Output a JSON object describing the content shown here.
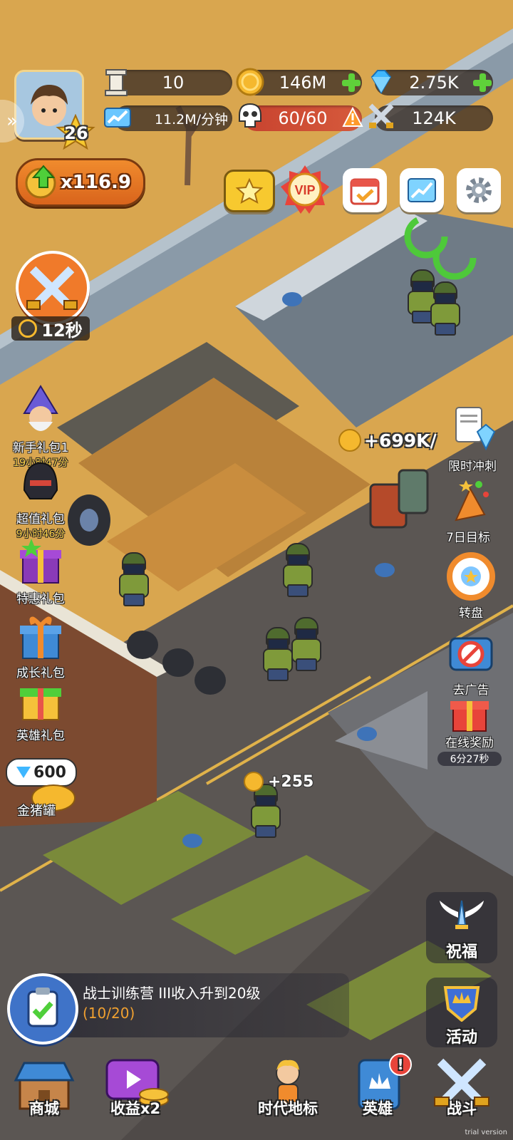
{
  "hud": {
    "level": "26",
    "pillar_count": "10",
    "coins": "146M",
    "gems": "2.75K",
    "income_rate": "11.2M/分钟",
    "population": "60/60",
    "power": "124K",
    "multiplier": "x116.9",
    "battle_timer": "12秒"
  },
  "left_menu": [
    {
      "label": "新手礼包1",
      "timer": "19小时47分"
    },
    {
      "label": "超值礼包",
      "timer": "9小时46分"
    },
    {
      "label": "特惠礼包",
      "timer": ""
    },
    {
      "label": "成长礼包",
      "timer": ""
    },
    {
      "label": "英雄礼包",
      "timer": ""
    }
  ],
  "piggy": {
    "value": "600",
    "label": "金猪罐"
  },
  "right_menu": [
    {
      "label": "限时冲刺"
    },
    {
      "label": "7日目标"
    },
    {
      "label": "转盘"
    },
    {
      "label": "去广告"
    },
    {
      "label": "在线奖励",
      "timer": "6分27秒"
    }
  ],
  "map_floats": {
    "income_popup": "+699K/",
    "coin_popup": "+255"
  },
  "right_bottom": {
    "blessing": "祝福",
    "activity": "活动"
  },
  "quest": {
    "title": "战士训练营 III收入升到20级",
    "progress": "(10/20)"
  },
  "bottom_nav": [
    {
      "label": "商城"
    },
    {
      "label": "收益x2"
    },
    {
      "label": "时代地标"
    },
    {
      "label": "英雄"
    },
    {
      "label": "战斗"
    }
  ],
  "watermark": "trial version",
  "colors": {
    "ground": "#d9a64f",
    "road": "#5a5a5a",
    "gem": "#3fb7ff",
    "coin": "#f5b82e",
    "plus": "#5fd13a"
  }
}
